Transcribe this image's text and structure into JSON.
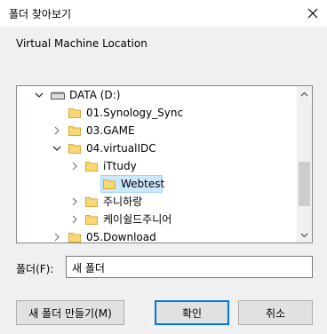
{
  "window": {
    "title": "폴더 찾아보기"
  },
  "prompt": "Virtual Machine Location",
  "tree": {
    "items": [
      {
        "label": "DATA (D:)",
        "type": "drive",
        "expanded": true
      },
      {
        "label": "01.Synology_Sync",
        "type": "folder",
        "expanded": false
      },
      {
        "label": "03.GAME",
        "type": "folder",
        "expanded": false
      },
      {
        "label": "04.virtualIDC",
        "type": "folder",
        "expanded": true
      },
      {
        "label": "iTtudy",
        "type": "folder",
        "expanded": false
      },
      {
        "label": "Webtest",
        "type": "folder",
        "selected": true
      },
      {
        "label": "주니하랑",
        "type": "folder",
        "expanded": false
      },
      {
        "label": "케이쉴드주니어",
        "type": "folder",
        "expanded": false
      },
      {
        "label": "05.Download",
        "type": "folder",
        "expanded": false
      }
    ]
  },
  "folder_field": {
    "label": "폴더(F):",
    "value": "새 폴더"
  },
  "buttons": {
    "new_folder": "새 폴더 만들기(M)",
    "ok": "확인",
    "cancel": "취소"
  },
  "colors": {
    "selection": "#cce8ff",
    "folder": "#f8d775",
    "accent": "#0078d7"
  }
}
